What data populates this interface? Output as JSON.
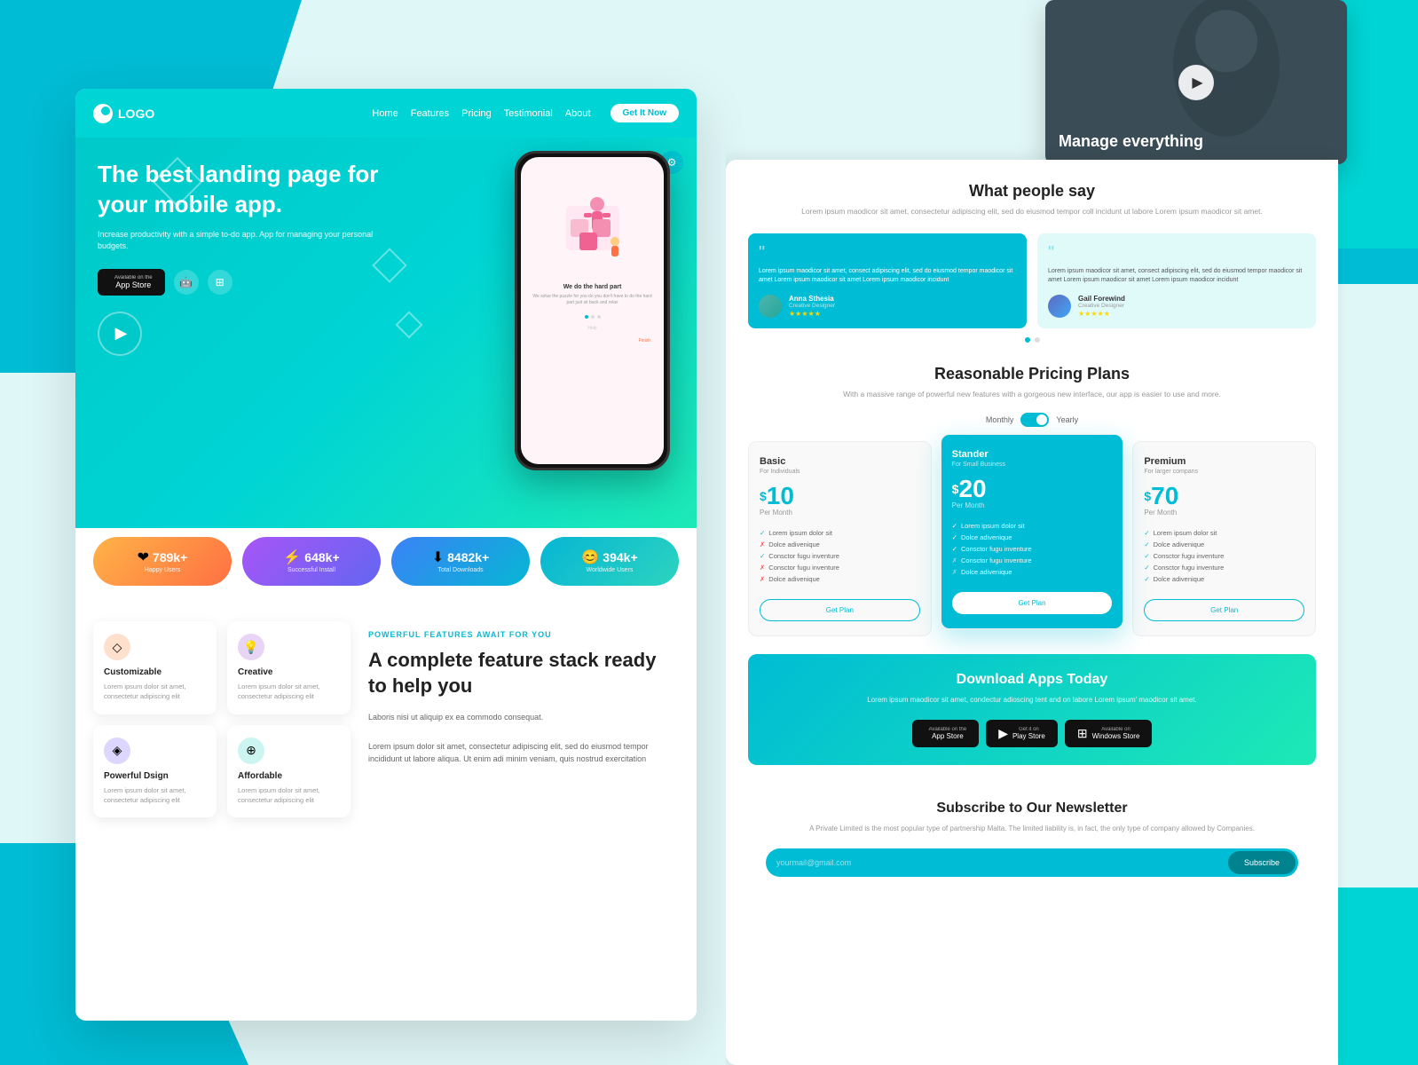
{
  "nav": {
    "logo": "LOGO",
    "links": [
      "Home",
      "Features",
      "Pricing",
      "Testimonial",
      "About"
    ],
    "cta": "Get It Now"
  },
  "hero": {
    "title": "The best landing page for your mobile app.",
    "description": "Increase productivity with a simple to-do app. App for managing your personal budgets.",
    "appstore_label": "Available on the\nApp Store",
    "appstore_main": "App Store"
  },
  "stats": [
    {
      "number": "789k+",
      "label": "Happy Users",
      "icon": "❤"
    },
    {
      "number": "648k+",
      "label": "Successful Install",
      "icon": "⚡"
    },
    {
      "number": "8482k+",
      "label": "Total Downloads",
      "icon": "⬇"
    },
    {
      "number": "394k+",
      "label": "Worldwide Users",
      "icon": "😊"
    }
  ],
  "features": {
    "tag": "POWERFUL FEATURES AWAIT FOR YOU",
    "heading": "A complete feature stack ready to help you",
    "body1": "Laboris nisi ut aliquip ex ea commodo consequat.",
    "body2": "Lorem ipsum dolor sit amet, consectetur adipiscing elit, sed do eiusmod tempor incididunt ut labore aliqua. Ut enim adi minim veniam, quis nostrud exercitation",
    "cards": [
      {
        "title": "Customizable",
        "desc": "Lorem ipsum dolor sit amet, consectetur adipiscing elit",
        "icon": "◇",
        "iconClass": "icon-peach"
      },
      {
        "title": "Creative",
        "desc": "Lorem ipsum dolor sit amet, consectetur adipiscing elit",
        "icon": "💡",
        "iconClass": "icon-purple"
      },
      {
        "title": "Powerful Dsign",
        "desc": "Lorem ipsum dolor sit amet, consectetur adipiscing elit",
        "icon": "◈",
        "iconClass": "icon-indigo"
      },
      {
        "title": "Affordable",
        "desc": "Lorem ipsum dolor sit amet, consectetur adipiscing elit",
        "icon": "⊕",
        "iconClass": "icon-teal"
      }
    ]
  },
  "video": {
    "title": "Manage everything",
    "play_label": "Play video"
  },
  "testimonials": {
    "heading": "What people say",
    "desc": "Lorem ipsum maodicor sit amet, consectetur adipiscing elit, sed do eiusmod tempor\ncoll incidunt ut labore Lorem ipsum maodicor sit amet.",
    "cards": [
      {
        "text": "Lorem ipsum maodicor sit amet, consect adipiscing elit, sed do eiusmod tempor maodicor sit amet Lorem ipsum maodicor sit amet Lorem ipsum maodicor incidunt",
        "name": "Anna Sthesia",
        "role": "Creative Designer",
        "stars": "★★★★★",
        "variant": "teal"
      },
      {
        "text": "Lorem ipsum maodicor sit amet, consect adipiscing elit, sed do eiusmod tempor maodicor sit amet Lorem ipsum maodicor sit amet Lorem ipsum maodicor incidunt",
        "name": "Gail Forewind",
        "role": "Creative Designer",
        "stars": "★★★★★",
        "variant": "light"
      }
    ]
  },
  "pricing": {
    "heading": "Reasonable Pricing Plans",
    "desc": "With a massive range of powerful new features with a gorgeous new\ninterface, our app is easier to use and more.",
    "toggle_monthly": "Monthly",
    "toggle_yearly": "Yearly",
    "plans": [
      {
        "name": "Basic",
        "for": "For Individuals",
        "price": "10",
        "period": "Per Month",
        "featured": false,
        "features": [
          {
            "text": "Lorem ipsum dolor sit",
            "check": true
          },
          {
            "text": "Dolce adivenique",
            "check": false
          },
          {
            "text": "Consctor fugu inventure",
            "check": true
          },
          {
            "text": "Consctor fugu inventure",
            "check": false
          },
          {
            "text": "Dolce adivenique",
            "check": false
          }
        ],
        "btn": "Get Plan"
      },
      {
        "name": "Stander",
        "for": "For Small Business",
        "price": "20",
        "period": "Per Month",
        "featured": true,
        "features": [
          {
            "text": "Lorem ipsum dolor sit",
            "check": true
          },
          {
            "text": "Dolce adivenique",
            "check": true
          },
          {
            "text": "Consctor fugu inventure",
            "check": true
          },
          {
            "text": "Consctor fugu inventure",
            "check": false
          },
          {
            "text": "Dolce adivenique",
            "check": false
          }
        ],
        "btn": "Get Plan"
      },
      {
        "name": "Premium",
        "for": "For larger compans",
        "price": "70",
        "period": "Per Month",
        "featured": false,
        "features": [
          {
            "text": "Lorem ipsum dolor sit",
            "check": true
          },
          {
            "text": "Dolce adivenique",
            "check": true
          },
          {
            "text": "Consctor fugu inventure",
            "check": true
          },
          {
            "text": "Consctor fugu inventure",
            "check": true
          },
          {
            "text": "Dolce adivenique",
            "check": true
          }
        ],
        "btn": "Get Plan"
      }
    ]
  },
  "download": {
    "heading": "Download Apps Today",
    "desc": "Lorem ipsum maodicor sit amet, condectur adioscing tent and on labore Lorem ipsum' maodicor sit amet.",
    "btns": [
      {
        "label": "App Store",
        "sublabel": "Available on the",
        "icon": ""
      },
      {
        "label": "Play Store",
        "sublabel": "Get it on",
        "icon": "▶"
      },
      {
        "label": "Windows Store",
        "sublabel": "Available on",
        "icon": "⊞"
      }
    ]
  },
  "newsletter": {
    "heading": "Subscribe to Our Newsletter",
    "desc": "A Private Limited is the most popular type of partnership Malta. The limited liability is, in fact, the only type of company allowed by Companies.",
    "placeholder": "yourmail@gmail.com",
    "btn_label": "Subscribe"
  },
  "colors": {
    "primary": "#00bcd4",
    "accent": "#1de9b6",
    "dark": "#111111"
  }
}
